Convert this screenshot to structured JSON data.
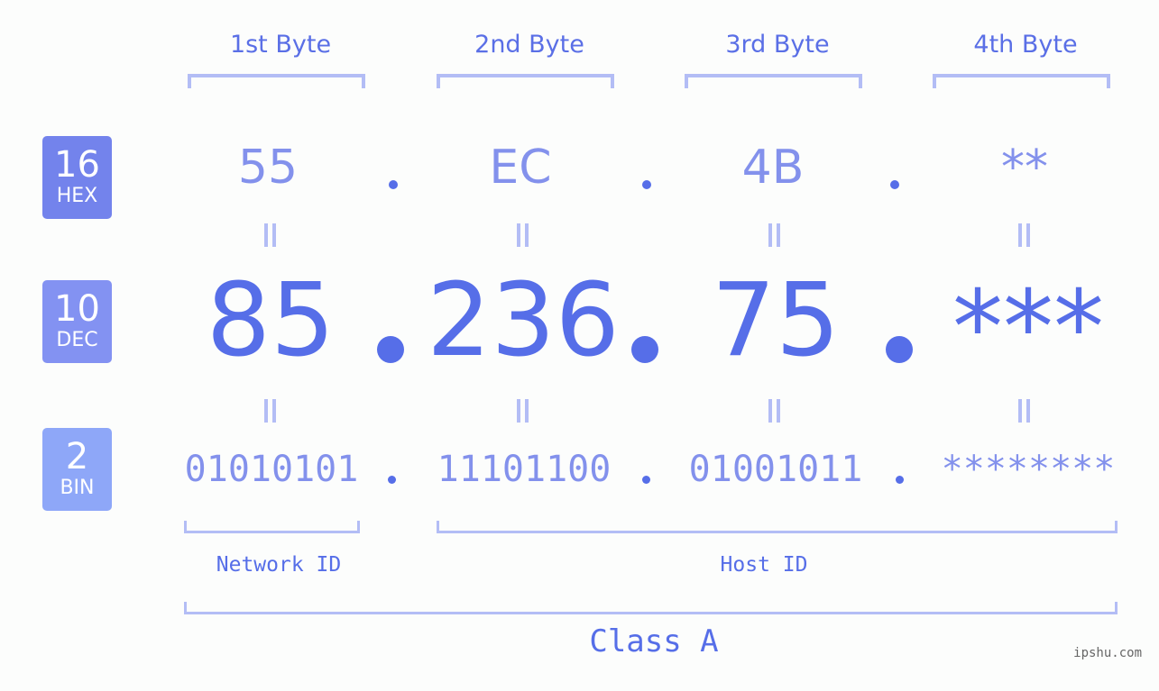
{
  "colors": {
    "hex_badge": "#7383ec",
    "dec_badge": "#8392f2",
    "bin_badge": "#8ea7f8",
    "primary": "#566ee8",
    "secondary": "#8391ec",
    "bracket": "#b3bdf5"
  },
  "bases": [
    {
      "number": "16",
      "label": "HEX"
    },
    {
      "number": "10",
      "label": "DEC"
    },
    {
      "number": "2",
      "label": "BIN"
    }
  ],
  "bytes": [
    {
      "label": "1st Byte",
      "hex": "55",
      "dec": "85",
      "bin": "01010101"
    },
    {
      "label": "2nd Byte",
      "hex": "EC",
      "dec": "236",
      "bin": "11101100"
    },
    {
      "label": "3rd Byte",
      "hex": "4B",
      "dec": "75",
      "bin": "01001011"
    },
    {
      "label": "4th Byte",
      "hex": "**",
      "dec": "***",
      "bin": "********"
    }
  ],
  "separator": ".",
  "network_id_label": "Network ID",
  "host_id_label": "Host ID",
  "class_label": "Class A",
  "watermark": "ipshu.com"
}
